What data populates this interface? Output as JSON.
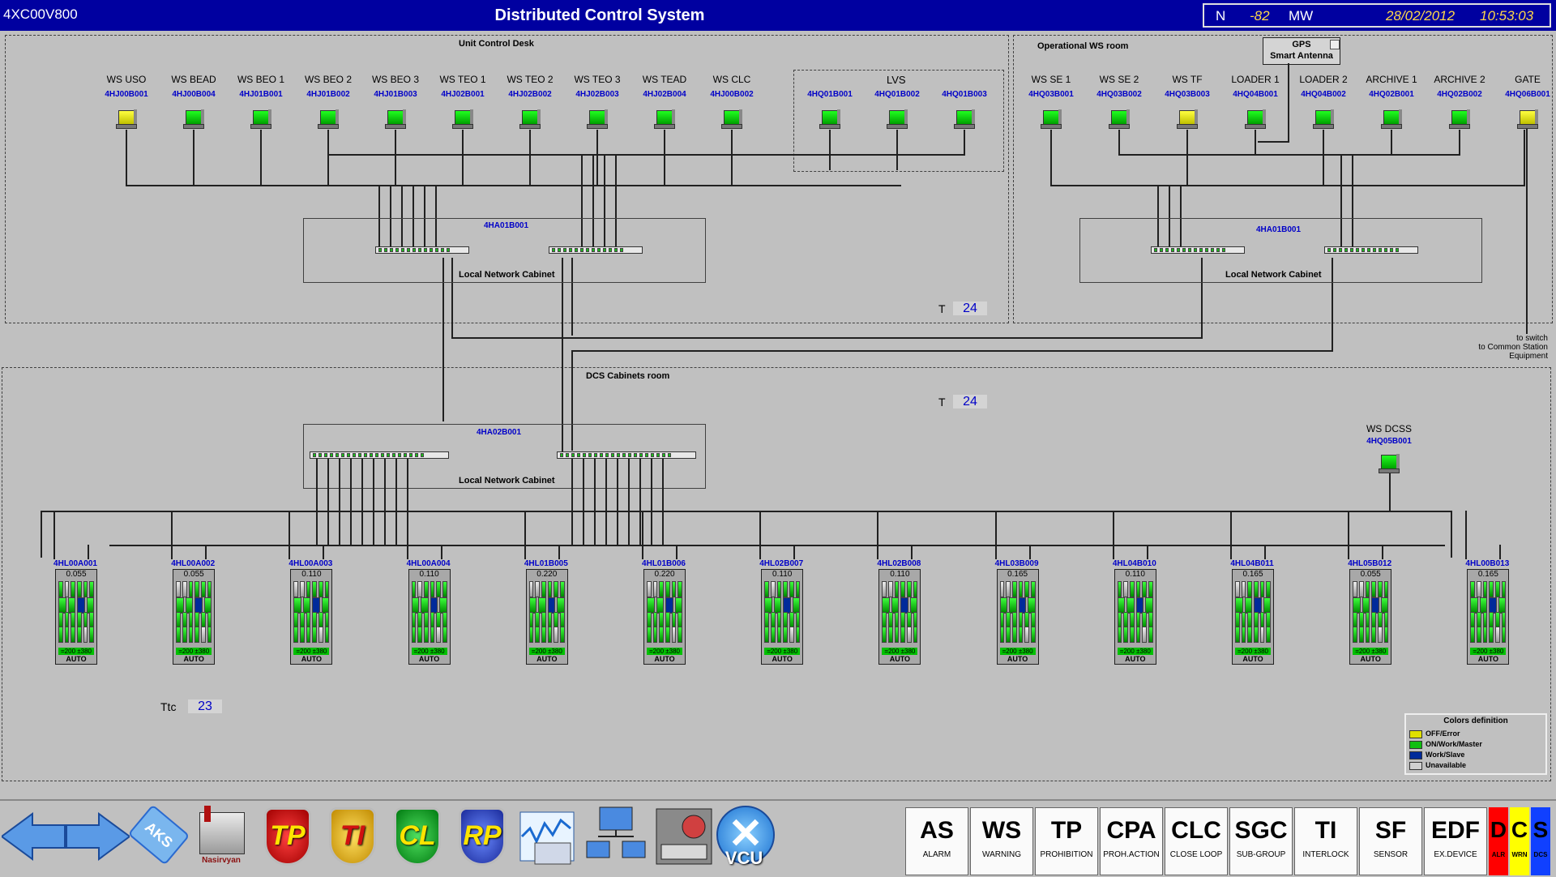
{
  "title_bar": {
    "id": "4XC00V800",
    "title": "Distributed Control System",
    "n_label": "N",
    "n_value": "-82",
    "unit": "MW",
    "date": "28/02/2012",
    "time": "10:53:03"
  },
  "zones": {
    "unit_control_desk": "Unit Control Desk",
    "operational_ws_room": "Operational WS room",
    "dcs_cabinets_room": "DCS Cabinets room",
    "lvs": "LVS"
  },
  "gps": {
    "line1": "GPS",
    "line2": "Smart Antenna"
  },
  "workstations_ucd": [
    {
      "name": "WS USO",
      "code": "4HJ00B001",
      "status": "yellow"
    },
    {
      "name": "WS BEAD",
      "code": "4HJ00B004",
      "status": "green"
    },
    {
      "name": "WS BEO 1",
      "code": "4HJ01B001",
      "status": "green"
    },
    {
      "name": "WS BEO 2",
      "code": "4HJ01B002",
      "status": "green"
    },
    {
      "name": "WS BEO 3",
      "code": "4HJ01B003",
      "status": "green"
    },
    {
      "name": "WS TEO 1",
      "code": "4HJ02B001",
      "status": "green"
    },
    {
      "name": "WS TEO 2",
      "code": "4HJ02B002",
      "status": "green"
    },
    {
      "name": "WS TEO 3",
      "code": "4HJ02B003",
      "status": "green"
    },
    {
      "name": "WS TEAD",
      "code": "4HJ02B004",
      "status": "green"
    },
    {
      "name": "WS CLC",
      "code": "4HJ00B002",
      "status": "green"
    }
  ],
  "workstations_lvs": [
    {
      "code": "4HQ01B001",
      "status": "green"
    },
    {
      "code": "4HQ01B002",
      "status": "green"
    },
    {
      "code": "4HQ01B003",
      "status": "green"
    }
  ],
  "workstations_ows": [
    {
      "name": "WS SE 1",
      "code": "4HQ03B001",
      "status": "green"
    },
    {
      "name": "WS SE 2",
      "code": "4HQ03B002",
      "status": "green"
    },
    {
      "name": "WS TF",
      "code": "4HQ03B003",
      "status": "yellow"
    },
    {
      "name": "LOADER 1",
      "code": "4HQ04B001",
      "status": "green"
    },
    {
      "name": "LOADER 2",
      "code": "4HQ04B002",
      "status": "green"
    },
    {
      "name": "ARCHIVE 1",
      "code": "4HQ02B001",
      "status": "green"
    },
    {
      "name": "ARCHIVE 2",
      "code": "4HQ02B002",
      "status": "green"
    },
    {
      "name": "GATE",
      "code": "4HQ06B001",
      "status": "yellow"
    }
  ],
  "cabinets": {
    "ucd": {
      "code": "4HA01B001",
      "label": "Local Network Cabinet"
    },
    "ows": {
      "code": "4HA01B001",
      "label": "Local Network Cabinet"
    },
    "dcs": {
      "code": "4HA02B001",
      "label": "Local Network Cabinet"
    }
  },
  "temps": {
    "t_label": "T",
    "t_ucd": "24",
    "t_dcs": "24",
    "ttc_label": "Ttc",
    "ttc": "23"
  },
  "ws_dcss": {
    "name": "WS DCSS",
    "code": "4HQ05B001",
    "status": "green"
  },
  "switch_note": [
    "to switch",
    "to Common Station",
    "Equipment"
  ],
  "racks": [
    {
      "code": "4HL00A001",
      "value": "0.055",
      "power": "=200 ±380",
      "mode": "AUTO"
    },
    {
      "code": "4HL00A002",
      "value": "0.055",
      "power": "=200 ±380",
      "mode": "AUTO"
    },
    {
      "code": "4HL00A003",
      "value": "0.110",
      "power": "=200 ±380",
      "mode": "AUTO"
    },
    {
      "code": "4HL00A004",
      "value": "0.110",
      "power": "=200 ±380",
      "mode": "AUTO"
    },
    {
      "code": "4HL01B005",
      "value": "0.220",
      "power": "=200 ±380",
      "mode": "AUTO"
    },
    {
      "code": "4HL01B006",
      "value": "0.220",
      "power": "=200 ±380",
      "mode": "AUTO"
    },
    {
      "code": "4HL02B007",
      "value": "0.110",
      "power": "=200 ±380",
      "mode": "AUTO"
    },
    {
      "code": "4HL02B008",
      "value": "0.110",
      "power": "=200 ±380",
      "mode": "AUTO"
    },
    {
      "code": "4HL03B009",
      "value": "0.165",
      "power": "=200 ±380",
      "mode": "AUTO"
    },
    {
      "code": "4HL04B010",
      "value": "0.110",
      "power": "=200 ±380",
      "mode": "AUTO"
    },
    {
      "code": "4HL04B011",
      "value": "0.165",
      "power": "=200 ±380",
      "mode": "AUTO"
    },
    {
      "code": "4HL05B012",
      "value": "0.055",
      "power": "=200 ±380",
      "mode": "AUTO"
    },
    {
      "code": "4HL00B013",
      "value": "0.165",
      "power": "=200 ±380",
      "mode": "AUTO"
    }
  ],
  "legend": {
    "title": "Colors definition",
    "items": [
      {
        "label": "OFF/Error",
        "color": "#e0e000"
      },
      {
        "label": "ON/Work/Master",
        "color": "#10c010"
      },
      {
        "label": "Work/Slave",
        "color": "#002a9a"
      },
      {
        "label": "Unavailable",
        "color": "#d0d0d0"
      }
    ]
  },
  "nav_icons": [
    {
      "name": "back-arrow-icon"
    },
    {
      "name": "forward-arrow-icon"
    },
    {
      "name": "aks-tag-icon",
      "label": "AKS"
    },
    {
      "name": "plant-icon",
      "label": "Nasirvyan"
    },
    {
      "name": "tp-shield-icon",
      "label": "TP",
      "color": "#d01010"
    },
    {
      "name": "ti-shield-icon",
      "label": "TI",
      "color": "#e8b400"
    },
    {
      "name": "cl-shield-icon",
      "label": "CL",
      "color": "#10a020"
    },
    {
      "name": "rp-shield-icon",
      "label": "RP",
      "color": "#2a4ad0"
    },
    {
      "name": "trend-icon"
    },
    {
      "name": "network-icon"
    },
    {
      "name": "control-panel-icon"
    },
    {
      "name": "vcu-close-icon",
      "label": "VCU"
    }
  ],
  "code_buttons": [
    {
      "code": "AS",
      "desc": "ALARM"
    },
    {
      "code": "WS",
      "desc": "WARNING"
    },
    {
      "code": "TP",
      "desc": "PROHIBITION"
    },
    {
      "code": "CPA",
      "desc": "PROH.ACTION"
    },
    {
      "code": "CLC",
      "desc": "CLOSE LOOP"
    },
    {
      "code": "SGC",
      "desc": "SUB-GROUP"
    },
    {
      "code": "TI",
      "desc": "INTERLOCK"
    },
    {
      "code": "SF",
      "desc": "SENSOR"
    },
    {
      "code": "EDF",
      "desc": "EX.DEVICE"
    }
  ],
  "dcs_indicators": [
    {
      "letter": "D",
      "desc": "ALR",
      "color": "#ff0000"
    },
    {
      "letter": "C",
      "desc": "WRN",
      "color": "#ffff00"
    },
    {
      "letter": "S",
      "desc": "DCS",
      "color": "#1040ff"
    }
  ]
}
